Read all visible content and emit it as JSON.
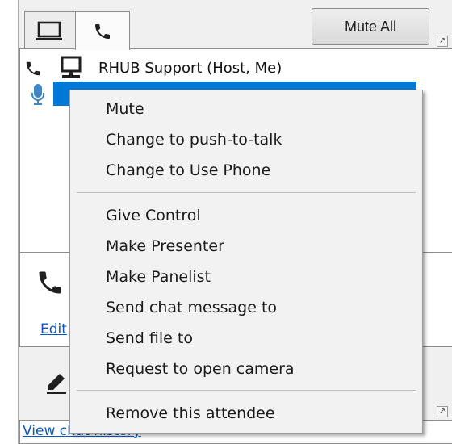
{
  "toolbar": {
    "mute_all_label": "Mute All"
  },
  "attendees": [
    {
      "name": "RHUB Support (Host, Me)"
    }
  ],
  "context_menu": {
    "items": [
      "Mute",
      "Change to push-to-talk",
      "Change to Use Phone",
      "Give Control",
      "Make Presenter",
      "Make Panelist",
      "Send chat message to",
      "Send file to",
      "Request to open camera",
      "Remove this attendee"
    ]
  },
  "links": {
    "edit": "Edit",
    "chat_history": "View chat history"
  },
  "colors": {
    "selection": "#0078d7",
    "link": "#0b56c0",
    "mic_icon": "#3c86c8"
  },
  "icons": [
    "monitor-icon",
    "phone-icon",
    "microphone-icon",
    "pencil-icon",
    "expand-icon"
  ]
}
